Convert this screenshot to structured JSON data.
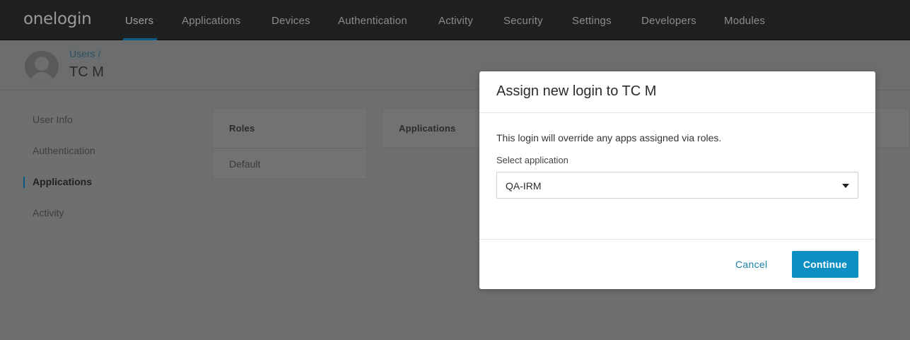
{
  "brand": {
    "logo_text": "onelogin"
  },
  "nav": {
    "items": [
      {
        "label": "Users"
      },
      {
        "label": "Applications"
      },
      {
        "label": "Devices"
      },
      {
        "label": "Authentication"
      },
      {
        "label": "Activity"
      },
      {
        "label": "Security"
      },
      {
        "label": "Settings"
      },
      {
        "label": "Developers"
      },
      {
        "label": "Modules"
      }
    ],
    "active": "Users"
  },
  "header": {
    "breadcrumb": "Users /",
    "title": "TC M"
  },
  "sidebar": {
    "items": [
      {
        "label": "User Info"
      },
      {
        "label": "Authentication"
      },
      {
        "label": "Applications"
      },
      {
        "label": "Activity"
      }
    ],
    "active": "Applications"
  },
  "roles_panel": {
    "header": "Roles",
    "rows": [
      "Default"
    ]
  },
  "apps_panel": {
    "header": "Applications"
  },
  "modal": {
    "title": "Assign new login to TC M",
    "message": "This login will override any apps assigned via roles.",
    "select_label": "Select application",
    "select_value": "QA-IRM",
    "cancel_label": "Cancel",
    "continue_label": "Continue"
  },
  "colors": {
    "accent": "#0e8fc4",
    "nav_bg": "#1f2021",
    "link": "#1a7ea9"
  }
}
